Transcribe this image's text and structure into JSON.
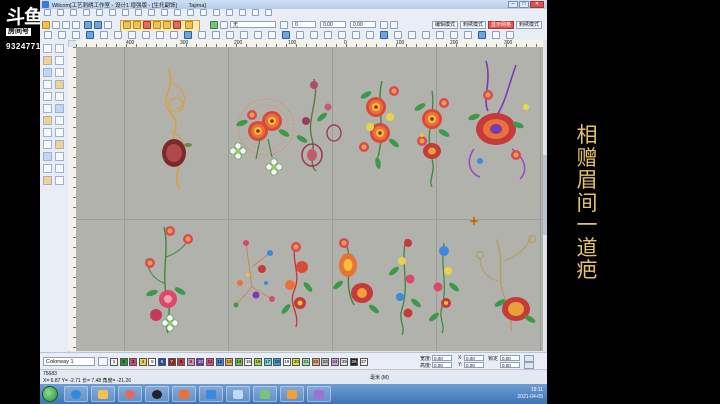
{
  "overlay": {
    "logo_main": "斗鱼",
    "logo_sub": "房间号",
    "room_id": "93247716",
    "side_chars": [
      "相",
      "赠",
      "眉",
      "间",
      "一",
      "道",
      "疤"
    ]
  },
  "window": {
    "title": "Wilcom[工艺刺绣工作室 - 设计1 增强版 - [生托副饰]",
    "title_extra": "Tajima]",
    "minimize_glyph": "–",
    "maximize_glyph": "□",
    "close_glyph": "✕"
  },
  "menu_icons": [
    "file-icon",
    "open-icon",
    "save-icon",
    "print-icon",
    "cut-icon",
    "copy-icon",
    "paste-icon",
    "undo-icon",
    "redo-icon",
    "zoom-icon",
    "grid-icon",
    "measure-icon",
    "color-icon",
    "layer-icon",
    "stitch-icon",
    "text-icon",
    "applique-icon",
    "help-icon"
  ],
  "toolbar2": {
    "fill_field": "无",
    "num_a": "0",
    "num_b": "0.00",
    "num_c": "0.00",
    "mode_button": "编辑模式",
    "mode_button2": "刺绣模式",
    "right_button": "显示网格",
    "highlight_button": "刺绣模式"
  },
  "ruler_labels": [
    "400",
    "300",
    "200",
    "100",
    "0",
    "100",
    "200",
    "300",
    "400"
  ],
  "colorbar": {
    "colorway_label": "Colorway 1",
    "swatches": [
      {
        "n": "1",
        "c": "#f2f2f2"
      },
      {
        "n": "2",
        "c": "#2f8f3f"
      },
      {
        "n": "3",
        "c": "#c74a7a"
      },
      {
        "n": "4",
        "c": "#e8d24a"
      },
      {
        "n": "5",
        "c": "#ffffff"
      },
      {
        "n": "6",
        "c": "#1f4fa8"
      },
      {
        "n": "7",
        "c": "#8a2a2a"
      },
      {
        "n": "8",
        "c": "#c73a3a"
      },
      {
        "n": "9",
        "c": "#d58ac0"
      },
      {
        "n": "10",
        "c": "#6a3aa8"
      },
      {
        "n": "11",
        "c": "#e04a8a"
      },
      {
        "n": "12",
        "c": "#3a8ae0"
      },
      {
        "n": "13",
        "c": "#e3b04a"
      },
      {
        "n": "14",
        "c": "#6ec24a"
      },
      {
        "n": "15",
        "c": "#f5f5f5"
      },
      {
        "n": "16",
        "c": "#a8d84a"
      },
      {
        "n": "17",
        "c": "#6ad8d8"
      },
      {
        "n": "18",
        "c": "#3aa0e0"
      },
      {
        "n": "19",
        "c": "#ffffff"
      },
      {
        "n": "20",
        "c": "#e0e040"
      },
      {
        "n": "21",
        "c": "#a0e0a0"
      },
      {
        "n": "22",
        "c": "#f0a070"
      },
      {
        "n": "23",
        "c": "#c0c0c0"
      },
      {
        "n": "24",
        "c": "#d0a0e0"
      },
      {
        "n": "25",
        "c": "#e0e0e0"
      },
      {
        "n": "26",
        "c": "#202020"
      },
      {
        "n": "27",
        "c": "#f0f0f0"
      }
    ],
    "width_label": "宽度:",
    "height_label": "高度:",
    "x_label": "X:",
    "y_label": "Y:",
    "width_value": "0.00",
    "height_value": "0.00",
    "x_value": "0.00",
    "y_value": "0.00",
    "lock_label": "锁定"
  },
  "status": {
    "stitch_count": "75683",
    "coords": "X= 6.87 Y= -2.71 长= 7.48 角度= -21.26",
    "unit": "毫米 (M)"
  },
  "taskbar": {
    "time": "19:11",
    "date": "2021-04-05"
  }
}
